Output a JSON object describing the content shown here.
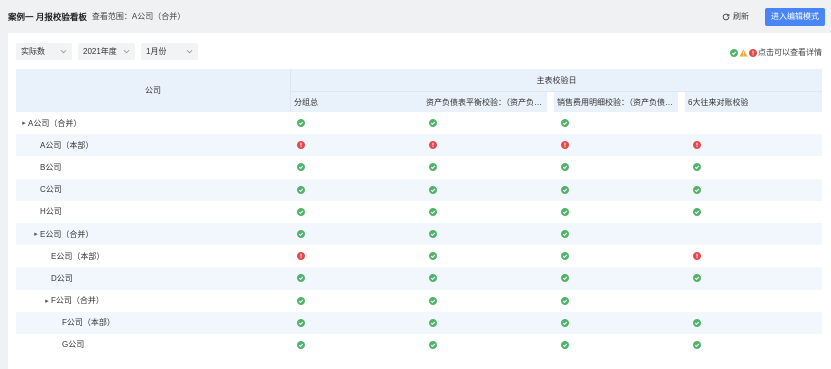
{
  "header": {
    "title": "案例一 月报校验看板",
    "scope": "查看范围：A公司（合并）",
    "refresh_label": "刷新",
    "edit_label": "进入编辑模式"
  },
  "filters": [
    {
      "value": "实际数"
    },
    {
      "value": "2021年度"
    },
    {
      "value": "1月份"
    }
  ],
  "legend": {
    "text": "点击可以查看详情"
  },
  "colors": {
    "ok": "#52b36a",
    "error": "#e5484d",
    "warn": "#f0a93b",
    "primary": "#4a85f5",
    "header_bg": "#e9f1fb",
    "alt_row": "#f2f7fd"
  },
  "table": {
    "company_header": "公司",
    "group_header": "主表校验日",
    "columns": [
      {
        "label": "分组总"
      },
      {
        "label": "资产负债表平衡校验：（资产负债表）"
      },
      {
        "label": "销售费用明细校验：（资产负债表）"
      },
      {
        "label": "6大往来对账校验"
      }
    ],
    "rows": [
      {
        "name": "A公司（合并）",
        "level": 0,
        "toggle": true,
        "status": [
          "ok",
          "ok",
          "ok",
          ""
        ]
      },
      {
        "name": "A公司（本部）",
        "level": 1,
        "toggle": false,
        "status": [
          "error",
          "error",
          "error",
          "error"
        ]
      },
      {
        "name": "B公司",
        "level": 1,
        "toggle": false,
        "status": [
          "ok",
          "ok",
          "ok",
          "ok"
        ]
      },
      {
        "name": "C公司",
        "level": 1,
        "toggle": false,
        "status": [
          "ok",
          "ok",
          "ok",
          "ok"
        ]
      },
      {
        "name": "H公司",
        "level": 1,
        "toggle": false,
        "status": [
          "ok",
          "ok",
          "ok",
          "ok"
        ]
      },
      {
        "name": "E公司（合并）",
        "level": 1,
        "toggle": true,
        "status": [
          "ok",
          "ok",
          "ok",
          ""
        ]
      },
      {
        "name": "E公司（本部）",
        "level": 2,
        "toggle": false,
        "status": [
          "error",
          "ok",
          "ok",
          "error"
        ]
      },
      {
        "name": "D公司",
        "level": 2,
        "toggle": false,
        "status": [
          "ok",
          "ok",
          "ok",
          "ok"
        ]
      },
      {
        "name": "F公司（合并）",
        "level": 2,
        "toggle": true,
        "status": [
          "ok",
          "ok",
          "ok",
          ""
        ]
      },
      {
        "name": "F公司（本部）",
        "level": 3,
        "toggle": false,
        "status": [
          "ok",
          "ok",
          "ok",
          "ok"
        ]
      },
      {
        "name": "G公司",
        "level": 3,
        "toggle": false,
        "status": [
          "ok",
          "ok",
          "ok",
          "ok"
        ]
      }
    ]
  }
}
